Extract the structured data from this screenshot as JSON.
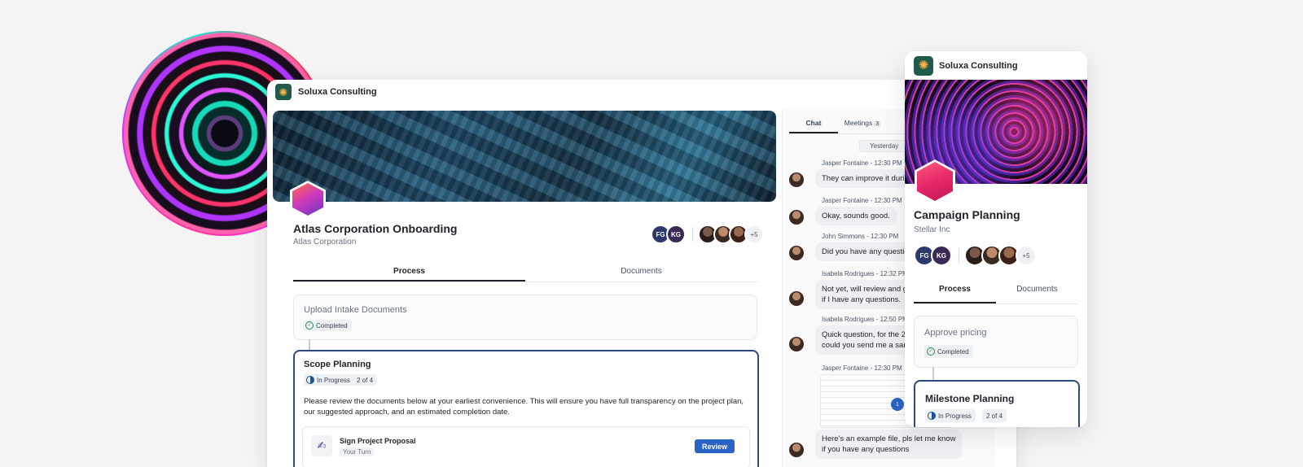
{
  "main": {
    "brand": "Soluxa Consulting",
    "project_title": "Atlas Corporation Onboarding",
    "project_subtitle": "Atlas Corporation",
    "avatars": {
      "fg": "FG",
      "kg": "KG",
      "more": "+5"
    },
    "tabs": [
      {
        "label": "Process"
      },
      {
        "label": "Documents"
      }
    ],
    "steps": [
      {
        "title": "Upload Intake Documents",
        "status": "Completed"
      },
      {
        "title": "Scope Planning",
        "status": "In Progress",
        "progress": "2 of 4",
        "description": "Please review the documents below at your earliest convenience. This will ensure you have full transparency on the project plan, our suggested approach, and an estimated completion date.",
        "task": {
          "title": "Sign Project Proposal",
          "subtitle": "Your Turn",
          "button": "Review"
        }
      }
    ]
  },
  "chat": {
    "tabs": [
      {
        "label": "Chat"
      },
      {
        "label": "Meetings",
        "count": "3"
      }
    ],
    "day": "Yesterday",
    "messages": [
      {
        "author": "Jasper Fontaine - 12:30 PM",
        "text": "They can improve it during"
      },
      {
        "author": "Jasper Fontaine - 12:30 PM",
        "text": "Okay, sounds good."
      },
      {
        "author": "John Simmons - 12:30 PM",
        "text": "Did you have any question"
      },
      {
        "author": "Isabela Rodrigues - 12:32 PM",
        "text": "Not yet, will review and ge",
        "text2": "if I have any questions."
      },
      {
        "author": "Isabela Rodrigues - 12:50 PM",
        "text": "Quick question, for the 20",
        "text2": "could you send me a samp"
      },
      {
        "author": "Jasper Fontaine - 12:30 PM",
        "text": "Here's an example file, pls let me know",
        "text2": "if you have any questions"
      }
    ]
  },
  "mobile": {
    "brand": "Soluxa Consulting",
    "project_title": "Campaign Planning",
    "project_subtitle": "Stellar Inc",
    "avatars": {
      "fg": "FG",
      "kg": "KG",
      "more": "+5"
    },
    "tabs": [
      {
        "label": "Process"
      },
      {
        "label": "Documents"
      }
    ],
    "steps": [
      {
        "title": "Approve pricing",
        "status": "Completed"
      },
      {
        "title": "Milestone Planning",
        "status": "In Progress",
        "progress": "2 of 4"
      }
    ]
  }
}
